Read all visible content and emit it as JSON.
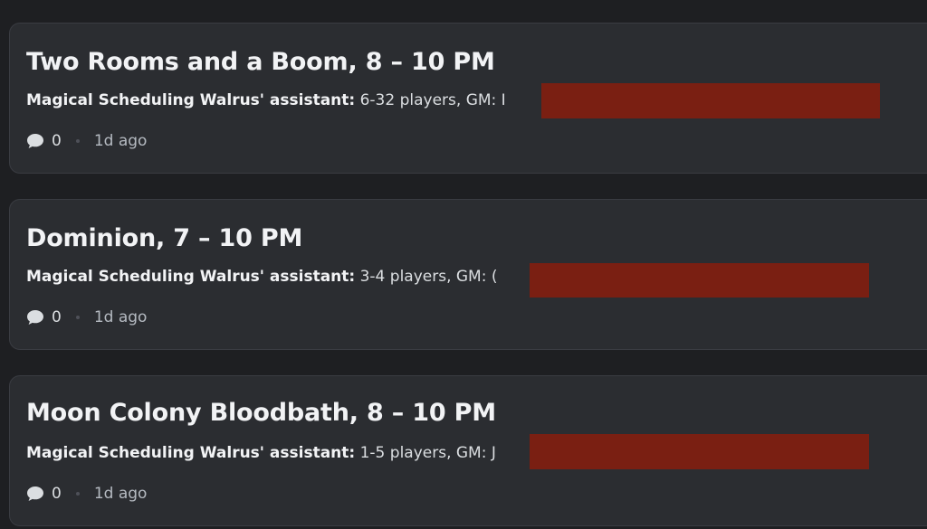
{
  "posts": [
    {
      "title": "Two Rooms and a Boom, 8 – 10 PM",
      "author": "Magical Scheduling Walrus' assistant:",
      "preview": " 6-32 players, GM: I",
      "replies": "0",
      "time": "1d ago"
    },
    {
      "title": "Dominion, 7 – 10 PM",
      "author": "Magical Scheduling Walrus' assistant:",
      "preview": " 3-4 players, GM: (",
      "replies": "0",
      "time": "1d ago"
    },
    {
      "title": "Moon Colony Bloodbath, 8 – 10 PM",
      "author": "Magical Scheduling Walrus' assistant:",
      "preview": " 1-5 players, GM: J",
      "replies": "0",
      "time": "1d ago"
    }
  ],
  "icons": {
    "reply": "speech-bubble-icon"
  },
  "colors": {
    "background": "#1e1f22",
    "card": "#2b2d31",
    "redaction": "#7a1f12"
  }
}
